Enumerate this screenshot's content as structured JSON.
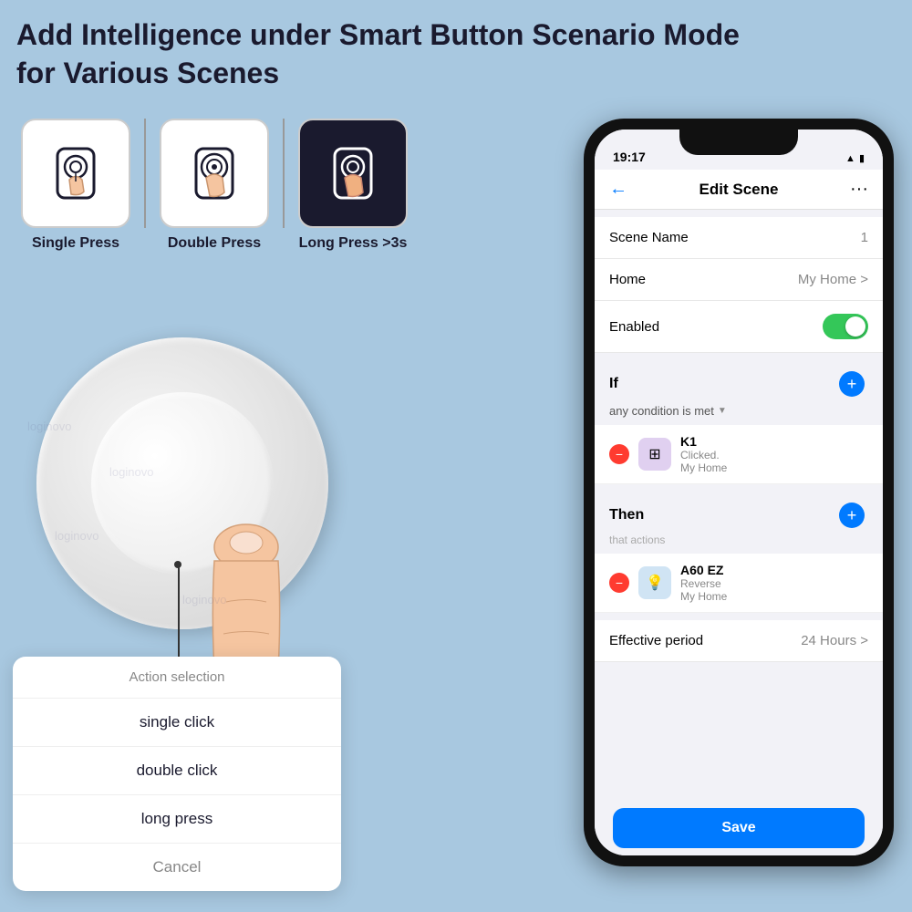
{
  "header": {
    "line1": "Add Intelligence under Smart Button Scenario Mode",
    "line2": "for Various Scenes"
  },
  "pressTypes": [
    {
      "label": "Single Press",
      "type": "single"
    },
    {
      "label": "Double Press",
      "type": "double"
    },
    {
      "label": "Long Press >3s",
      "type": "long"
    }
  ],
  "actionPopup": {
    "title": "Action selection",
    "items": [
      "single click",
      "double click",
      "long press"
    ],
    "cancel": "Cancel"
  },
  "phone": {
    "statusBar": {
      "time": "19:17",
      "wifi": "WiFi",
      "battery": "Battery"
    },
    "appHeader": {
      "title": "Edit Scene",
      "back": "←",
      "more": "···"
    },
    "rows": [
      {
        "label": "Scene Name",
        "value": "1"
      },
      {
        "label": "Home",
        "value": "My Home >"
      }
    ],
    "enabledLabel": "Enabled",
    "ifSection": {
      "header": "If",
      "subtext": "any condition is met",
      "item": {
        "name": "K1",
        "sub1": "Clicked.",
        "sub2": "My Home"
      }
    },
    "thenSection": {
      "header": "Then",
      "subtext": "that actions",
      "item": {
        "name": "A60 EZ",
        "sub1": "Reverse",
        "sub2": "My Home"
      }
    },
    "effectivePeriod": {
      "label": "Effective period",
      "value": "24 Hours >"
    },
    "saveButton": "Save"
  }
}
